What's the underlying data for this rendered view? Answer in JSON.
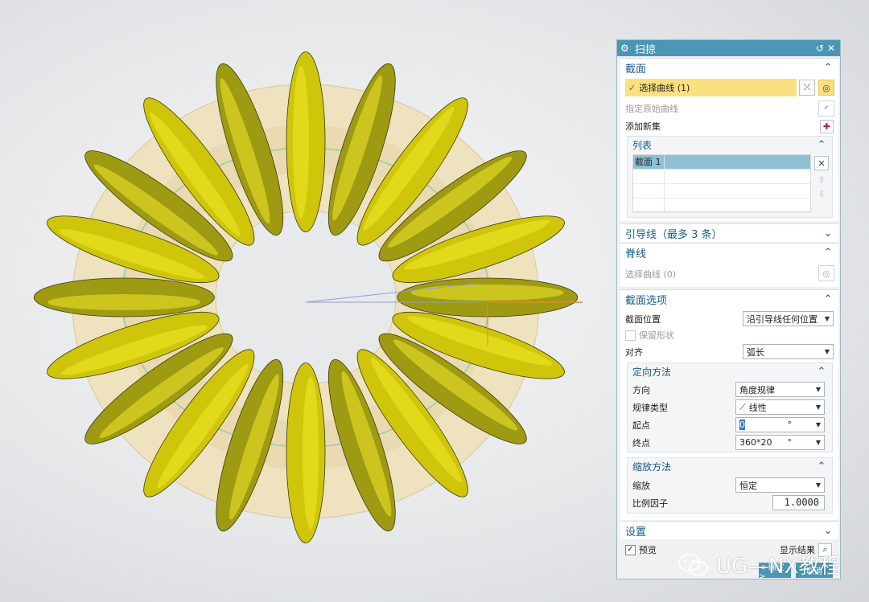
{
  "dialog": {
    "title": "扫掠",
    "section_section": {
      "label": "截面",
      "select_curve": "选择曲线 (1)",
      "specify_origin_curve": "指定原始曲线",
      "add_new_set": "添加新集",
      "list": {
        "label": "列表",
        "rows": [
          "截面 1",
          "",
          "",
          ""
        ]
      }
    },
    "guide_section": {
      "label": "引导线（最多 3 条）"
    },
    "spine_section": {
      "label": "脊线",
      "select_curve": "选择曲线 (0)"
    },
    "section_options": {
      "label": "截面选项",
      "section_location_label": "截面位置",
      "section_location_value": "沿引导线任何位置",
      "preserve_shape_label": "保留形状",
      "preserve_shape_checked": false,
      "alignment_label": "对齐",
      "alignment_value": "弧长",
      "orientation": {
        "label": "定向方法",
        "direction_label": "方向",
        "direction_value": "角度规律",
        "law_type_label": "规律类型",
        "law_type_value": "线性",
        "start_label": "起点",
        "start_value": "0",
        "start_unit": "°",
        "end_label": "终点",
        "end_value": "360*20",
        "end_unit": "°"
      },
      "scaling": {
        "label": "缩放方法",
        "scale_label": "缩放",
        "scale_value": "恒定",
        "factor_label": "比例因子",
        "factor_value": "1.0000"
      }
    },
    "settings_section": {
      "label": "设置"
    },
    "preview_label": "预览",
    "preview_checked": true,
    "show_result_label": "显示结果",
    "ok_label": "< 确定 >",
    "cancel_label": "取消"
  },
  "watermark": {
    "text": "UG—NX教程"
  },
  "colors": {
    "accent": "#4a97b5",
    "highlight": "#fbe081",
    "section_header": "#1b5d86",
    "surface": "#cfc50a"
  }
}
